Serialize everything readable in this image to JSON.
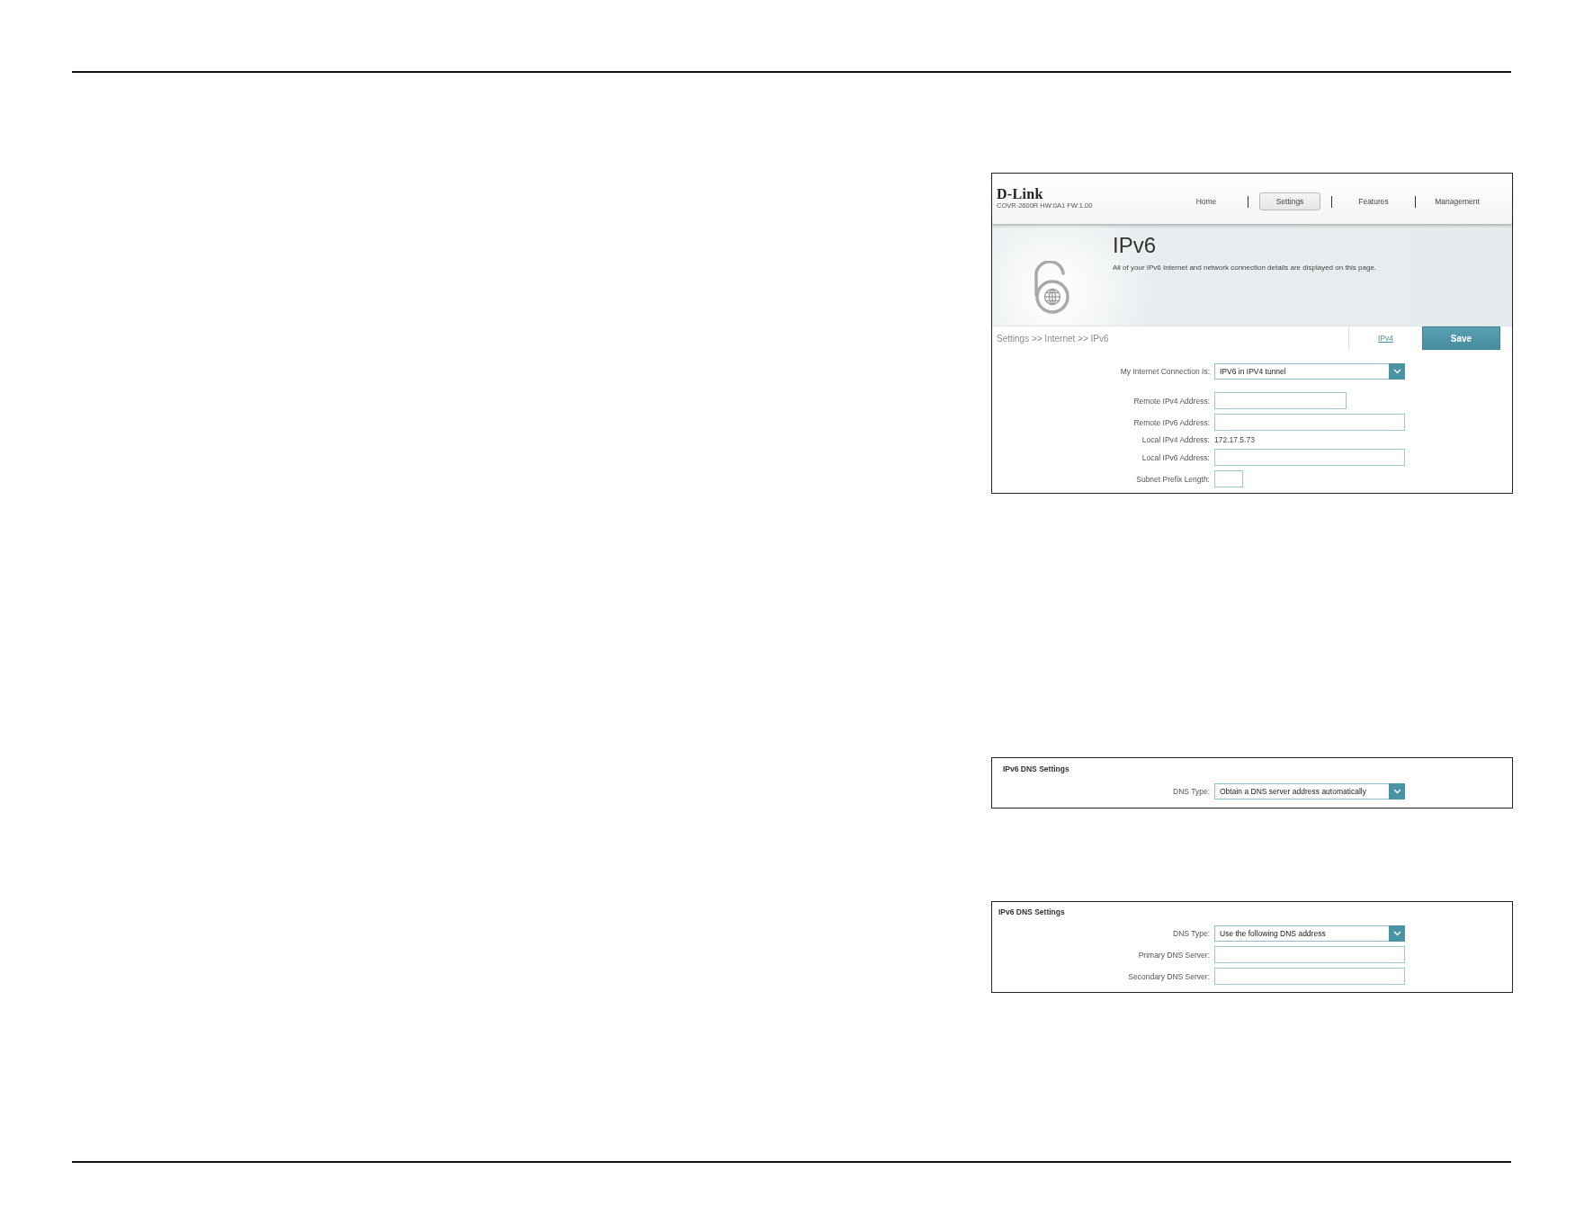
{
  "router_page": {
    "brand": {
      "logo": "D-Link",
      "model": "COVR-2600R HW:0A1 FW:1.00"
    },
    "nav": [
      {
        "label": "Home",
        "selected": false
      },
      {
        "label": "Settings",
        "selected": true
      },
      {
        "label": "Features",
        "selected": false
      },
      {
        "label": "Management",
        "selected": false
      }
    ],
    "banner": {
      "title": "IPv6",
      "description": "All of your IPv6 Internet and network connection details are displayed on this page."
    },
    "breadcrumb": "Settings >> Internet >> IPv6",
    "link": "IPv4",
    "save_button": "Save",
    "form": [
      {
        "label": "My Internet Connection Is:",
        "kind": "select",
        "value": "IPV6 in IPV4 tunnel"
      },
      {
        "label": "Remote IPv4 Address:",
        "kind": "short"
      },
      {
        "label": "Remote IPv6 Address:",
        "kind": "input"
      },
      {
        "label": "Local IPv4 Address:",
        "kind": "text",
        "value": "172.17.5.73"
      },
      {
        "label": "Local IPv6 Address:",
        "kind": "input"
      },
      {
        "label": "Subnet Prefix Length:",
        "kind": "tiny"
      }
    ]
  },
  "dns_panels": [
    {
      "heading": "IPv6 DNS Settings",
      "rows": [
        {
          "label": "DNS Type:",
          "kind": "select",
          "value": "Obtain a DNS server address automatically"
        }
      ]
    },
    {
      "heading": "IPv6 DNS Settings",
      "rows": [
        {
          "label": "DNS Type:",
          "kind": "select",
          "value": "Use the following DNS address"
        },
        {
          "label": "Primary DNS Server:",
          "kind": "input"
        },
        {
          "label": "Secondary DNS Server:",
          "kind": "input"
        }
      ]
    }
  ]
}
